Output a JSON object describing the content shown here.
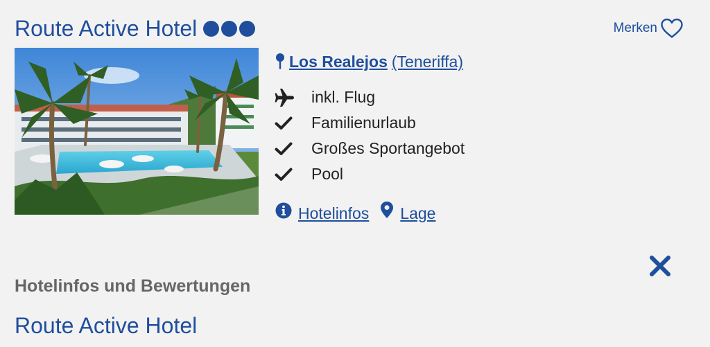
{
  "hotel": {
    "name": "Route Active Hotel",
    "rating_dots": 3,
    "accent_color": "#1f4e9c"
  },
  "merken": {
    "label": "Merken",
    "icon": "heart-outline-icon"
  },
  "location": {
    "city": "Los Realejos",
    "region": "(Teneriffa)",
    "icon": "map-pin-icon"
  },
  "features": [
    {
      "icon": "airplane-icon",
      "label": "inkl. Flug"
    },
    {
      "icon": "check-icon",
      "label": "Familienurlaub"
    },
    {
      "icon": "check-icon",
      "label": "Großes Sportangebot"
    },
    {
      "icon": "check-icon",
      "label": "Pool"
    }
  ],
  "links": {
    "hotelinfos": {
      "label": "Hotelinfos",
      "icon": "info-circle-icon"
    },
    "lage": {
      "label": "Lage",
      "icon": "location-marker-icon"
    }
  },
  "close": {
    "icon": "close-x-icon"
  },
  "section": {
    "heading": "Hotelinfos und Bewertungen",
    "title": "Route Active Hotel"
  }
}
